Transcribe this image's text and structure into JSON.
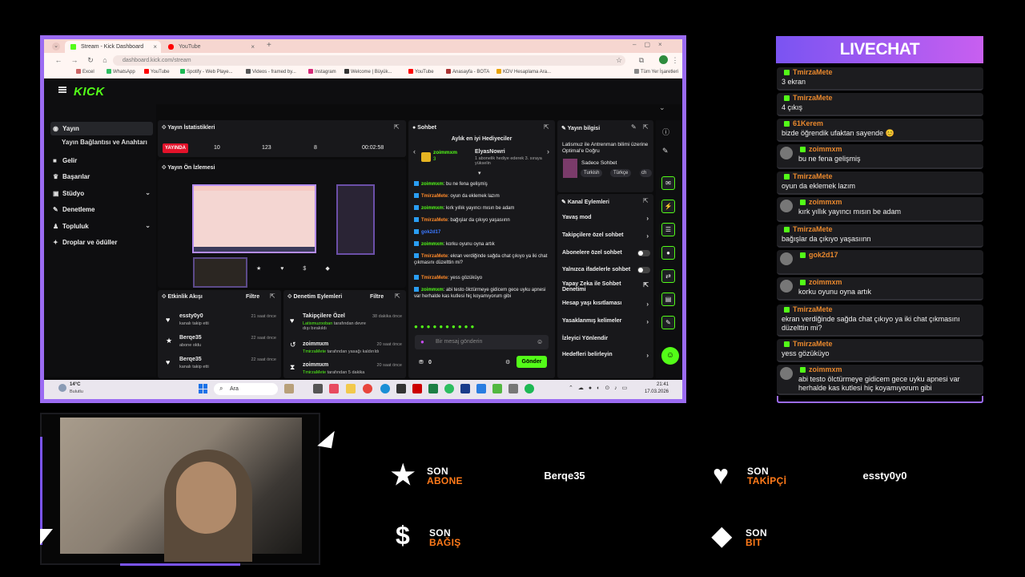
{
  "browser": {
    "tabs": [
      {
        "label": "Stream - Kick Dashboard",
        "active": true
      },
      {
        "label": "YouTube",
        "active": false
      }
    ],
    "address": "dashboard.kick.com/stream",
    "bookmarks": [
      "Excel",
      "WhatsApp",
      "YouTube",
      "Spotify - Web Playe...",
      "Videos - framed by...",
      "Instagram",
      "Welcome | Büyük...",
      "YouTube",
      "Anasayfa - BOTA",
      "KDV Hesaplama Ara..."
    ],
    "bookmarks_right": "Tüm Yer İşaretleri"
  },
  "kick": {
    "logo": "KICK",
    "sidebar": {
      "items": [
        {
          "label": "Yayın",
          "icon": "broadcast-icon"
        },
        {
          "label": "Gelir",
          "icon": "money-icon"
        },
        {
          "label": "Başarılar",
          "icon": "trophy-icon"
        },
        {
          "label": "Stüdyo",
          "icon": "studio-icon"
        },
        {
          "label": "Denetleme",
          "icon": "wrench-icon"
        },
        {
          "label": "Topluluk",
          "icon": "community-icon"
        },
        {
          "label": "Droplar ve ödüller",
          "icon": "drops-icon"
        }
      ],
      "sub": "Yayın Bağlantısı ve Anahtarı"
    },
    "stats": {
      "title": "Yayın İstatistikleri",
      "live": "YAYINDA",
      "viewers": "10",
      "followers": "123",
      "subs": "8",
      "duration": "00:02:58"
    },
    "preview": {
      "title": "Yayın Ön İzlemesi"
    },
    "activity": {
      "title": "Etkinlik Akışı",
      "filter": "Filtre",
      "items": [
        {
          "name": "essty0y0",
          "action": "kanalı takip etti",
          "time": "21 saat önce"
        },
        {
          "name": "Berqe35",
          "action": "abone oldu",
          "time": "22 saat önce"
        },
        {
          "name": "Berqe35",
          "action": "kanalı takip etti",
          "time": "22 saat önce"
        }
      ]
    },
    "moderation": {
      "title": "Denetim Eylemleri",
      "filter": "Filtre",
      "items": [
        {
          "title": "Takipçilere Özel",
          "sub_name": "Latismuzooban",
          "sub": "tarafından devre dışı bırakıldı",
          "time": "38 dakika önce"
        },
        {
          "title": "zoimmxm",
          "sub_name": "TmirzaMete",
          "sub": "tarafından yasağı kaldırıldı",
          "time": "20 saat önce"
        },
        {
          "title": "zoimmxm",
          "sub_name": "TmirzaMete",
          "sub": "tarafından 5 dakika",
          "time": "20 saat önce"
        }
      ]
    },
    "chat": {
      "title": "Sohbet",
      "gifters_title": "Aylık en iyi Hediyeciler",
      "gifter_1": "zoimmxm",
      "gifter_1_count": "3",
      "gifter_2": "ElyasNowri",
      "gifter_2_note": "1 abonelik hediye ederek 3. sıraya yükselin",
      "messages": [
        {
          "user": "zoimmxm",
          "text": "bu ne fena gelişmiş",
          "style": "z"
        },
        {
          "user": "TmirzaMete",
          "text": "oyun da eklemek lazım",
          "style": "n"
        },
        {
          "user": "zoimmxm",
          "text": "kırk yıllık yayıncı mısın be adam",
          "style": "z"
        },
        {
          "user": "TmirzaMete",
          "text": "bağışlar da çıkıyo yaşasıınn",
          "style": "n"
        },
        {
          "user": "gok2d17",
          "text": "",
          "style": "g"
        },
        {
          "user": "zoimmxm",
          "text": "korku oyunu oyna artık",
          "style": "z"
        },
        {
          "user": "TmirzaMete",
          "text": "ekran verdiğinde sağda chat çıkıyo ya iki chat çıkmasını düzelttin mi?",
          "style": "n"
        },
        {
          "user": "TmirzaMete",
          "text": "yess gözüküyo",
          "style": "n"
        },
        {
          "user": "zoimmxm",
          "text": "abi testo ölctürmeye gidicem gece uyku apnesi var herhalde kas kutlesi hiç koyamıyorum gibi",
          "style": "z"
        }
      ],
      "placeholder": "Bir mesaj gönderin",
      "count": "0",
      "send": "Gönder"
    },
    "stream_info": {
      "title": "Yayın bilgisi",
      "stream_title": "Latismuz ile Antrenman bilimi üzerine Optimal'e Doğru",
      "category": "Sadece Sohbet",
      "tags": [
        "Turkish",
        "Türkçe",
        "ch"
      ]
    },
    "channel_actions": {
      "title": "Kanal Eylemleri",
      "rows": [
        {
          "label": "Yavaş mod",
          "type": "arrow"
        },
        {
          "label": "Takipçilere özel sohbet",
          "type": "arrow"
        },
        {
          "label": "Abonelere özel sohbet",
          "type": "toggle"
        },
        {
          "label": "Yalnızca ifadelerle sohbet",
          "type": "toggle"
        },
        {
          "label": "Yapay Zeka ile Sohbet Denetimi",
          "type": "ext"
        },
        {
          "label": "Hesap yaşı kısıtlaması",
          "type": "arrow"
        },
        {
          "label": "Yasaklanmış kelimeler",
          "type": "arrow"
        },
        {
          "label": "İzleyici Yönlendir",
          "type": "none"
        },
        {
          "label": "Hedefleri belirleyin",
          "type": "arrow"
        }
      ]
    }
  },
  "taskbar": {
    "weather_temp": "14°C",
    "weather_desc": "Bulutlu",
    "search": "Ara",
    "time": "21:41",
    "date": "17.03.2026"
  },
  "livechat": {
    "title": "LIVECHAT",
    "messages": [
      {
        "user": "TmirzaMete",
        "text": "3 ekran",
        "avatar": false
      },
      {
        "user": "TmirzaMete",
        "text": "4 çıkış",
        "avatar": false
      },
      {
        "user": "61Kerem",
        "text": "bizde öğrendik ufaktan sayende 😊",
        "avatar": false
      },
      {
        "user": "zoimmxm",
        "text": "bu ne fena gelişmiş",
        "avatar": true
      },
      {
        "user": "TmirzaMete",
        "text": "oyun da eklemek lazım",
        "avatar": false
      },
      {
        "user": "zoimmxm",
        "text": "kırk yıllık yayıncı mısın be adam",
        "avatar": true
      },
      {
        "user": "TmirzaMete",
        "text": "bağışlar da çıkıyo yaşasıınn",
        "avatar": false
      },
      {
        "user": "gok2d17",
        "text": "",
        "avatar": true
      },
      {
        "user": "zoimmxm",
        "text": "korku oyunu oyna artık",
        "avatar": true
      },
      {
        "user": "TmirzaMete",
        "text": "ekran verdiğinde sağda chat çıkıyo ya iki chat çıkmasını düzelttin mi?",
        "avatar": false
      },
      {
        "user": "TmirzaMete",
        "text": "yess gözüküyo",
        "avatar": false
      },
      {
        "user": "zoimmxm",
        "text": "abi testo ölctürmeye gidicem gece uyku apnesi var herhalde kas kutlesi hiç koyamıyorum gibi",
        "avatar": true
      }
    ]
  },
  "alerts": {
    "son": "SON",
    "sub_label": "ABONE",
    "sub_user": "Berqe35",
    "follow_label": "TAKİPÇİ",
    "follow_user": "essty0y0",
    "donation_label": "BAĞIŞ",
    "bit_label": "BIT"
  },
  "colors": {
    "accent": "#9b6bf2",
    "kick_green": "#53fc18",
    "alert_orange": "#ff7a1a"
  }
}
